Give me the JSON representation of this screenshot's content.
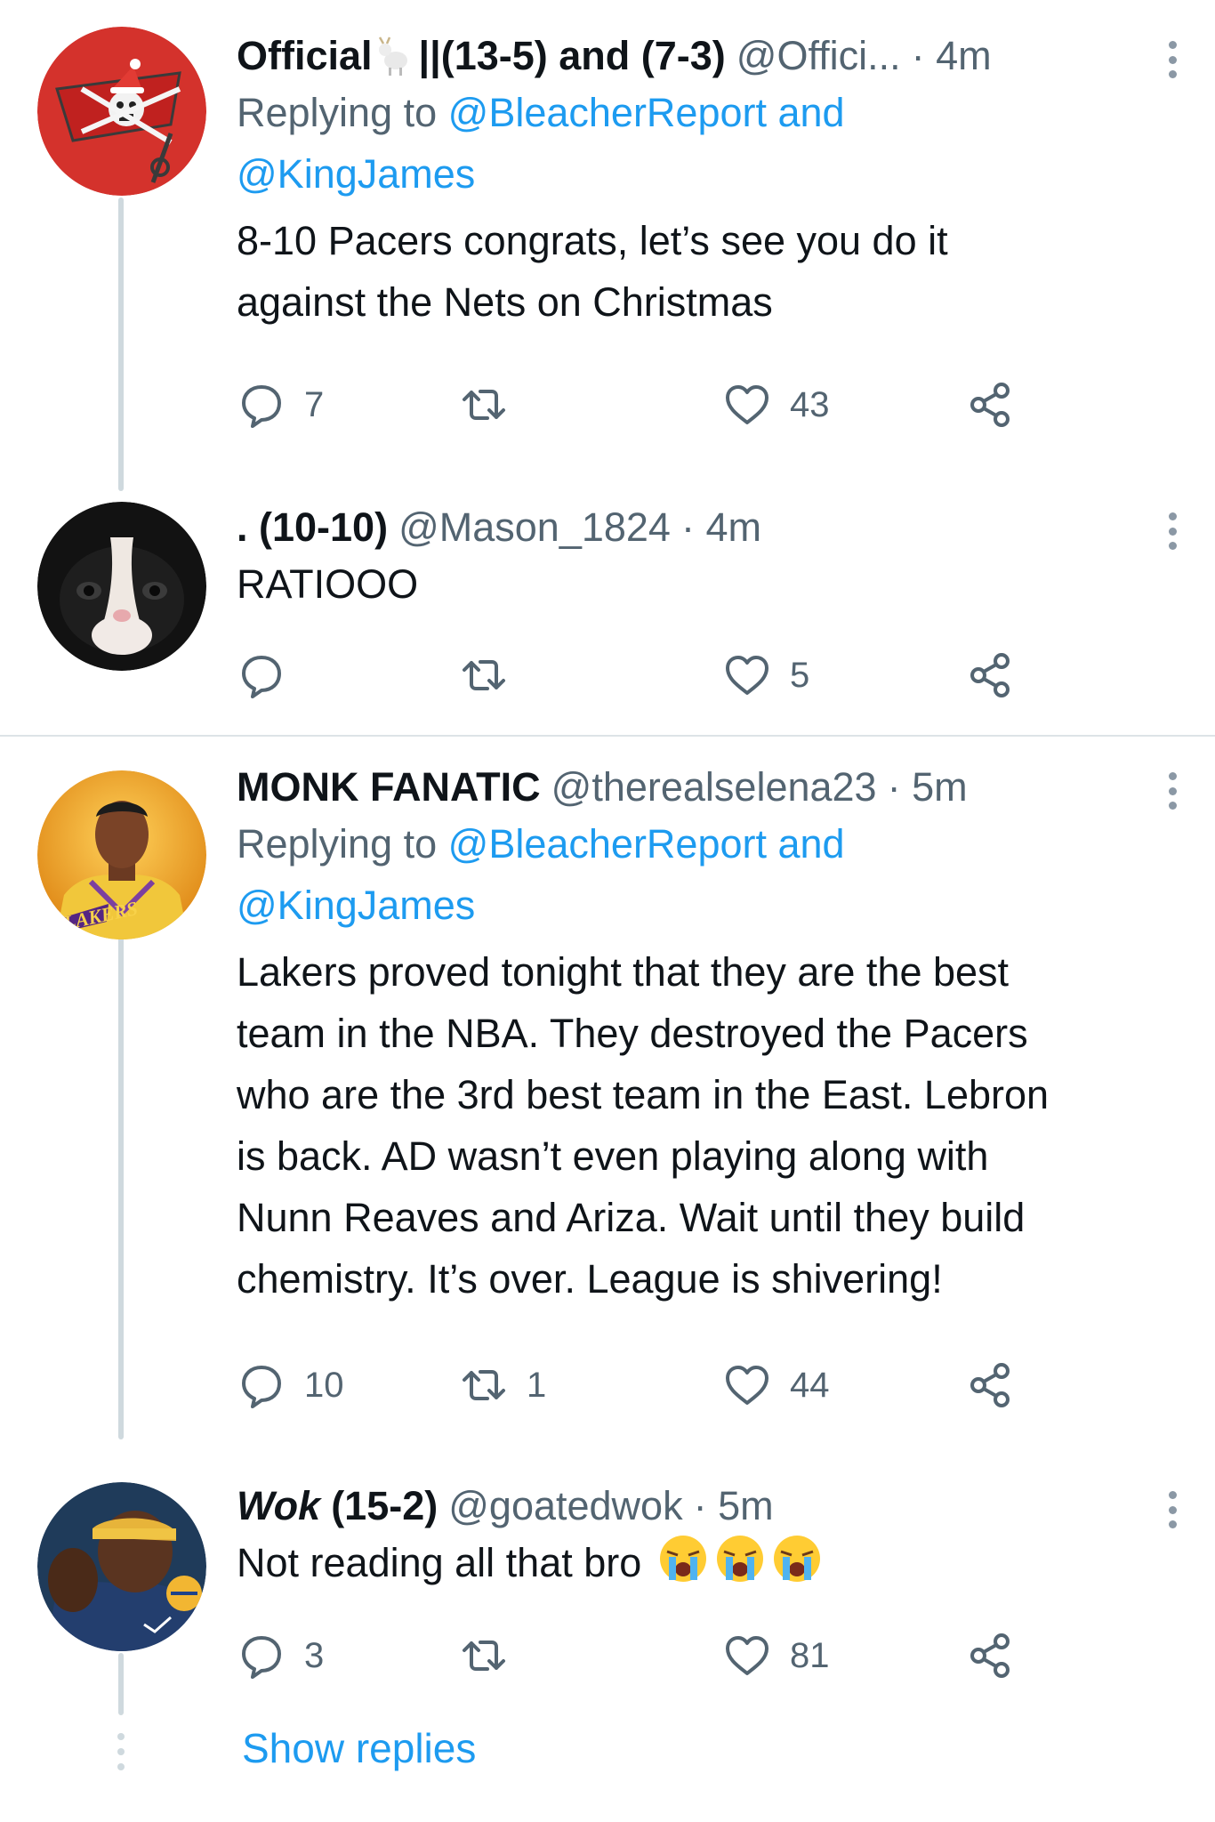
{
  "tweets": [
    {
      "name": "Official",
      "name_suffix": "||(13-5) and (7-3)",
      "handle": "@Offici...",
      "time": "· 4m",
      "replying_prefix": "Replying to ",
      "replying_to_1": "@BleacherReport",
      "replying_and": " and",
      "replying_to_2": "@KingJames",
      "text_lines": [
        "8-10 Pacers congrats, let’s see you do it",
        "against the Nets on Christmas"
      ],
      "replies": "7",
      "retweets": "",
      "likes": "43",
      "avatar": "buccaneers-flag-avatar"
    },
    {
      "name": ". (10-10)",
      "handle": "@Mason_1824",
      "time": "· 4m",
      "text_lines": [
        "RATIOOO"
      ],
      "replies": "",
      "retweets": "",
      "likes": "5",
      "avatar": "cat-avatar"
    },
    {
      "name": "MONK FANATIC",
      "handle": "@therealselena23",
      "time": "· 5m",
      "replying_prefix": "Replying to ",
      "replying_to_1": "@BleacherReport",
      "replying_and": " and",
      "replying_to_2": "@KingJames",
      "text_lines": [
        "Lakers proved tonight that they are the best",
        "team in the NBA. They destroyed the Pacers",
        "who are the 3rd best team in the East. Lebron",
        "is back. AD wasn’t even playing along with",
        "Nunn Reaves and Ariza. Wait until they build",
        "chemistry. It’s over. League is shivering!"
      ],
      "replies": "10",
      "retweets": "1",
      "likes": "44",
      "avatar": "lakers-player-avatar",
      "avatar_text": "LAKERS"
    },
    {
      "name": "Wok",
      "name_suffix": "(15-2)",
      "handle": "@goatedwok",
      "time": "· 5m",
      "text_lines": [
        "Not reading all that bro"
      ],
      "emoji": [
        "crying-face",
        "crying-face",
        "crying-face"
      ],
      "replies": "3",
      "retweets": "",
      "likes": "81",
      "avatar": "warriors-player-avatar"
    }
  ],
  "show_replies": "Show replies",
  "colors": {
    "link": "#1d9bf0",
    "muted": "#536471",
    "thread": "#cfd9de"
  },
  "icons": [
    "reply-icon",
    "retweet-icon",
    "like-icon",
    "share-icon",
    "goat-icon",
    "more-icon"
  ]
}
